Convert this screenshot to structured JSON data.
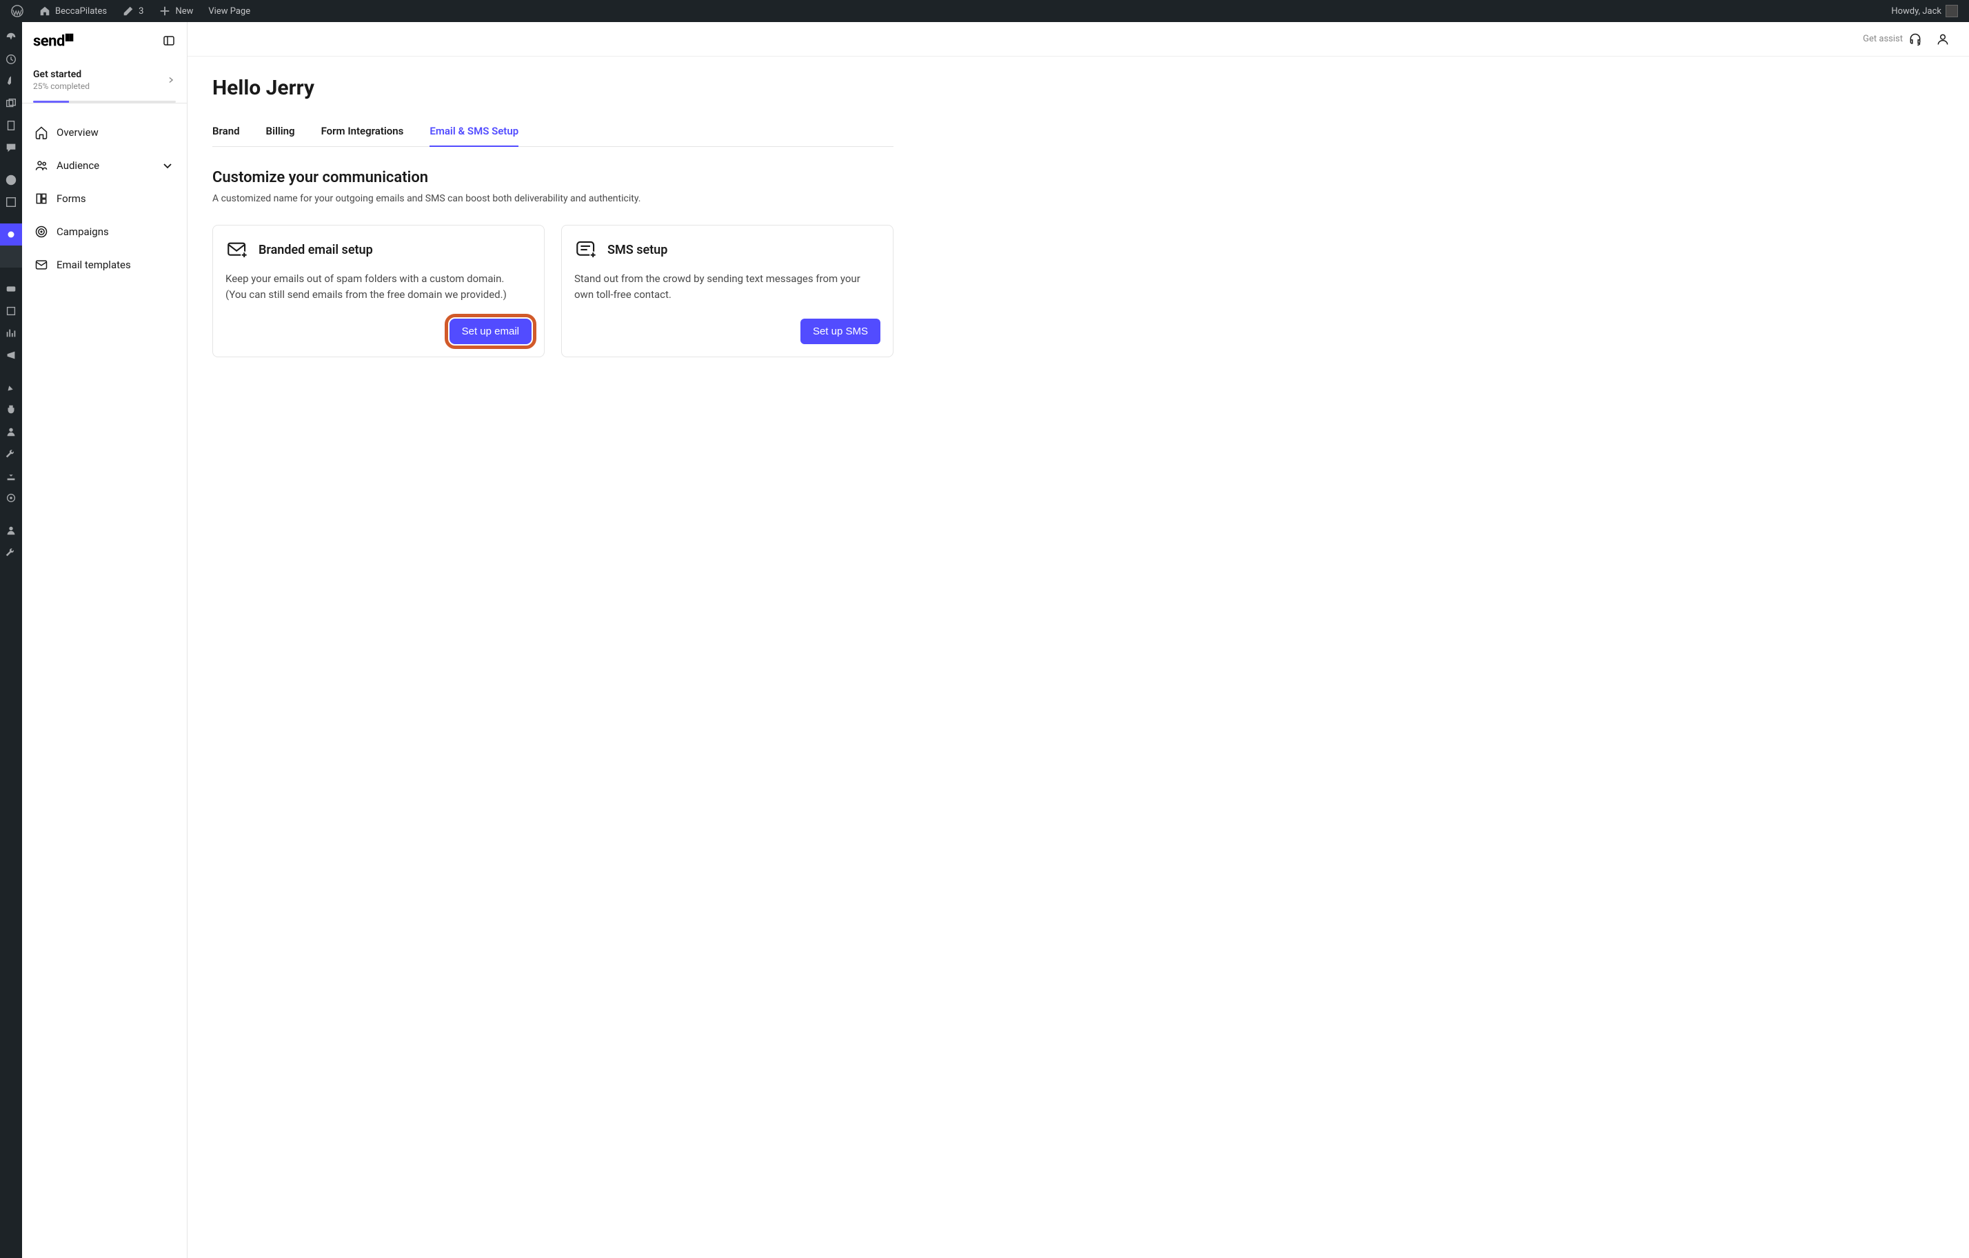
{
  "wp_bar": {
    "site_name": "BeccaPilates",
    "edit_count": "3",
    "new_label": "New",
    "view_page": "View Page",
    "howdy": "Howdy, Jack"
  },
  "send_sidebar": {
    "logo": "send",
    "get_started": {
      "title": "Get started",
      "subtitle": "25% completed",
      "progress_percent": 25
    },
    "nav": [
      {
        "label": "Overview"
      },
      {
        "label": "Audience"
      },
      {
        "label": "Forms"
      },
      {
        "label": "Campaigns"
      },
      {
        "label": "Email templates"
      }
    ]
  },
  "topbar": {
    "assist": "Get assist"
  },
  "page": {
    "title": "Hello Jerry",
    "tabs": [
      {
        "label": "Brand",
        "active": false
      },
      {
        "label": "Billing",
        "active": false
      },
      {
        "label": "Form Integrations",
        "active": false
      },
      {
        "label": "Email & SMS Setup",
        "active": true
      }
    ],
    "section_title": "Customize your communication",
    "section_sub": "A customized name for your outgoing emails and SMS can boost both deliverability and authenticity.",
    "cards": {
      "email": {
        "title": "Branded email setup",
        "body_line1": "Keep your emails out of spam folders with a custom domain.",
        "body_line2": "(You can still send emails from the free domain we provided.)",
        "button": "Set up email"
      },
      "sms": {
        "title": "SMS setup",
        "body": "Stand out from the crowd by sending text messages from your own toll-free contact.",
        "button": "Set up SMS"
      }
    }
  },
  "colors": {
    "accent": "#524cff",
    "highlight": "#d15a2a"
  }
}
